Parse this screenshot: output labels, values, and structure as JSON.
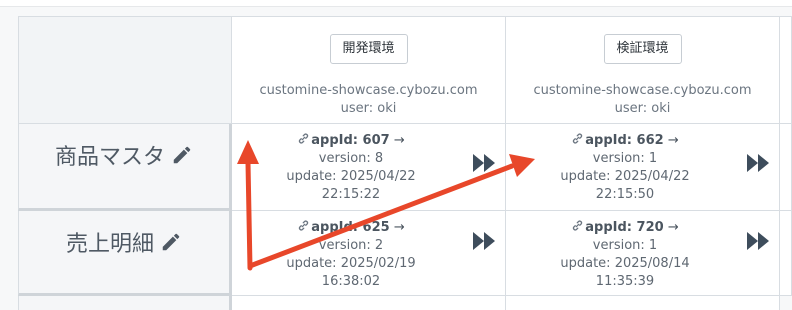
{
  "environments": [
    {
      "button_label": "開発環境",
      "domain": "customine-showcase.cybozu.com",
      "user": "user: oki"
    },
    {
      "button_label": "検証環境",
      "domain": "customine-showcase.cybozu.com",
      "user": "user: oki"
    }
  ],
  "rows": [
    {
      "label": "商品マスタ",
      "apps": [
        {
          "app_id": "appId: 607",
          "arrow": "→",
          "version": "version: 8",
          "update_date": "update: 2025/04/22",
          "update_time": "22:15:22"
        },
        {
          "app_id": "appId: 662",
          "arrow": "→",
          "version": "version: 1",
          "update_date": "update: 2025/04/22",
          "update_time": "22:15:50"
        }
      ]
    },
    {
      "label": "売上明細",
      "apps": [
        {
          "app_id": "appId: 625",
          "arrow": "→",
          "version": "version: 2",
          "update_date": "update: 2025/02/19",
          "update_time": "16:38:02"
        },
        {
          "app_id": "appId: 720",
          "arrow": "→",
          "version": "version: 1",
          "update_date": "update: 2025/08/14",
          "update_time": "11:35:39"
        }
      ]
    }
  ],
  "icons": {
    "edit": "pencil-icon",
    "link": "link-icon",
    "deploy": "fast-forward-icon"
  },
  "colors": {
    "annotation_arrow": "#e8472a",
    "forward_icon": "#3e4d5c"
  }
}
